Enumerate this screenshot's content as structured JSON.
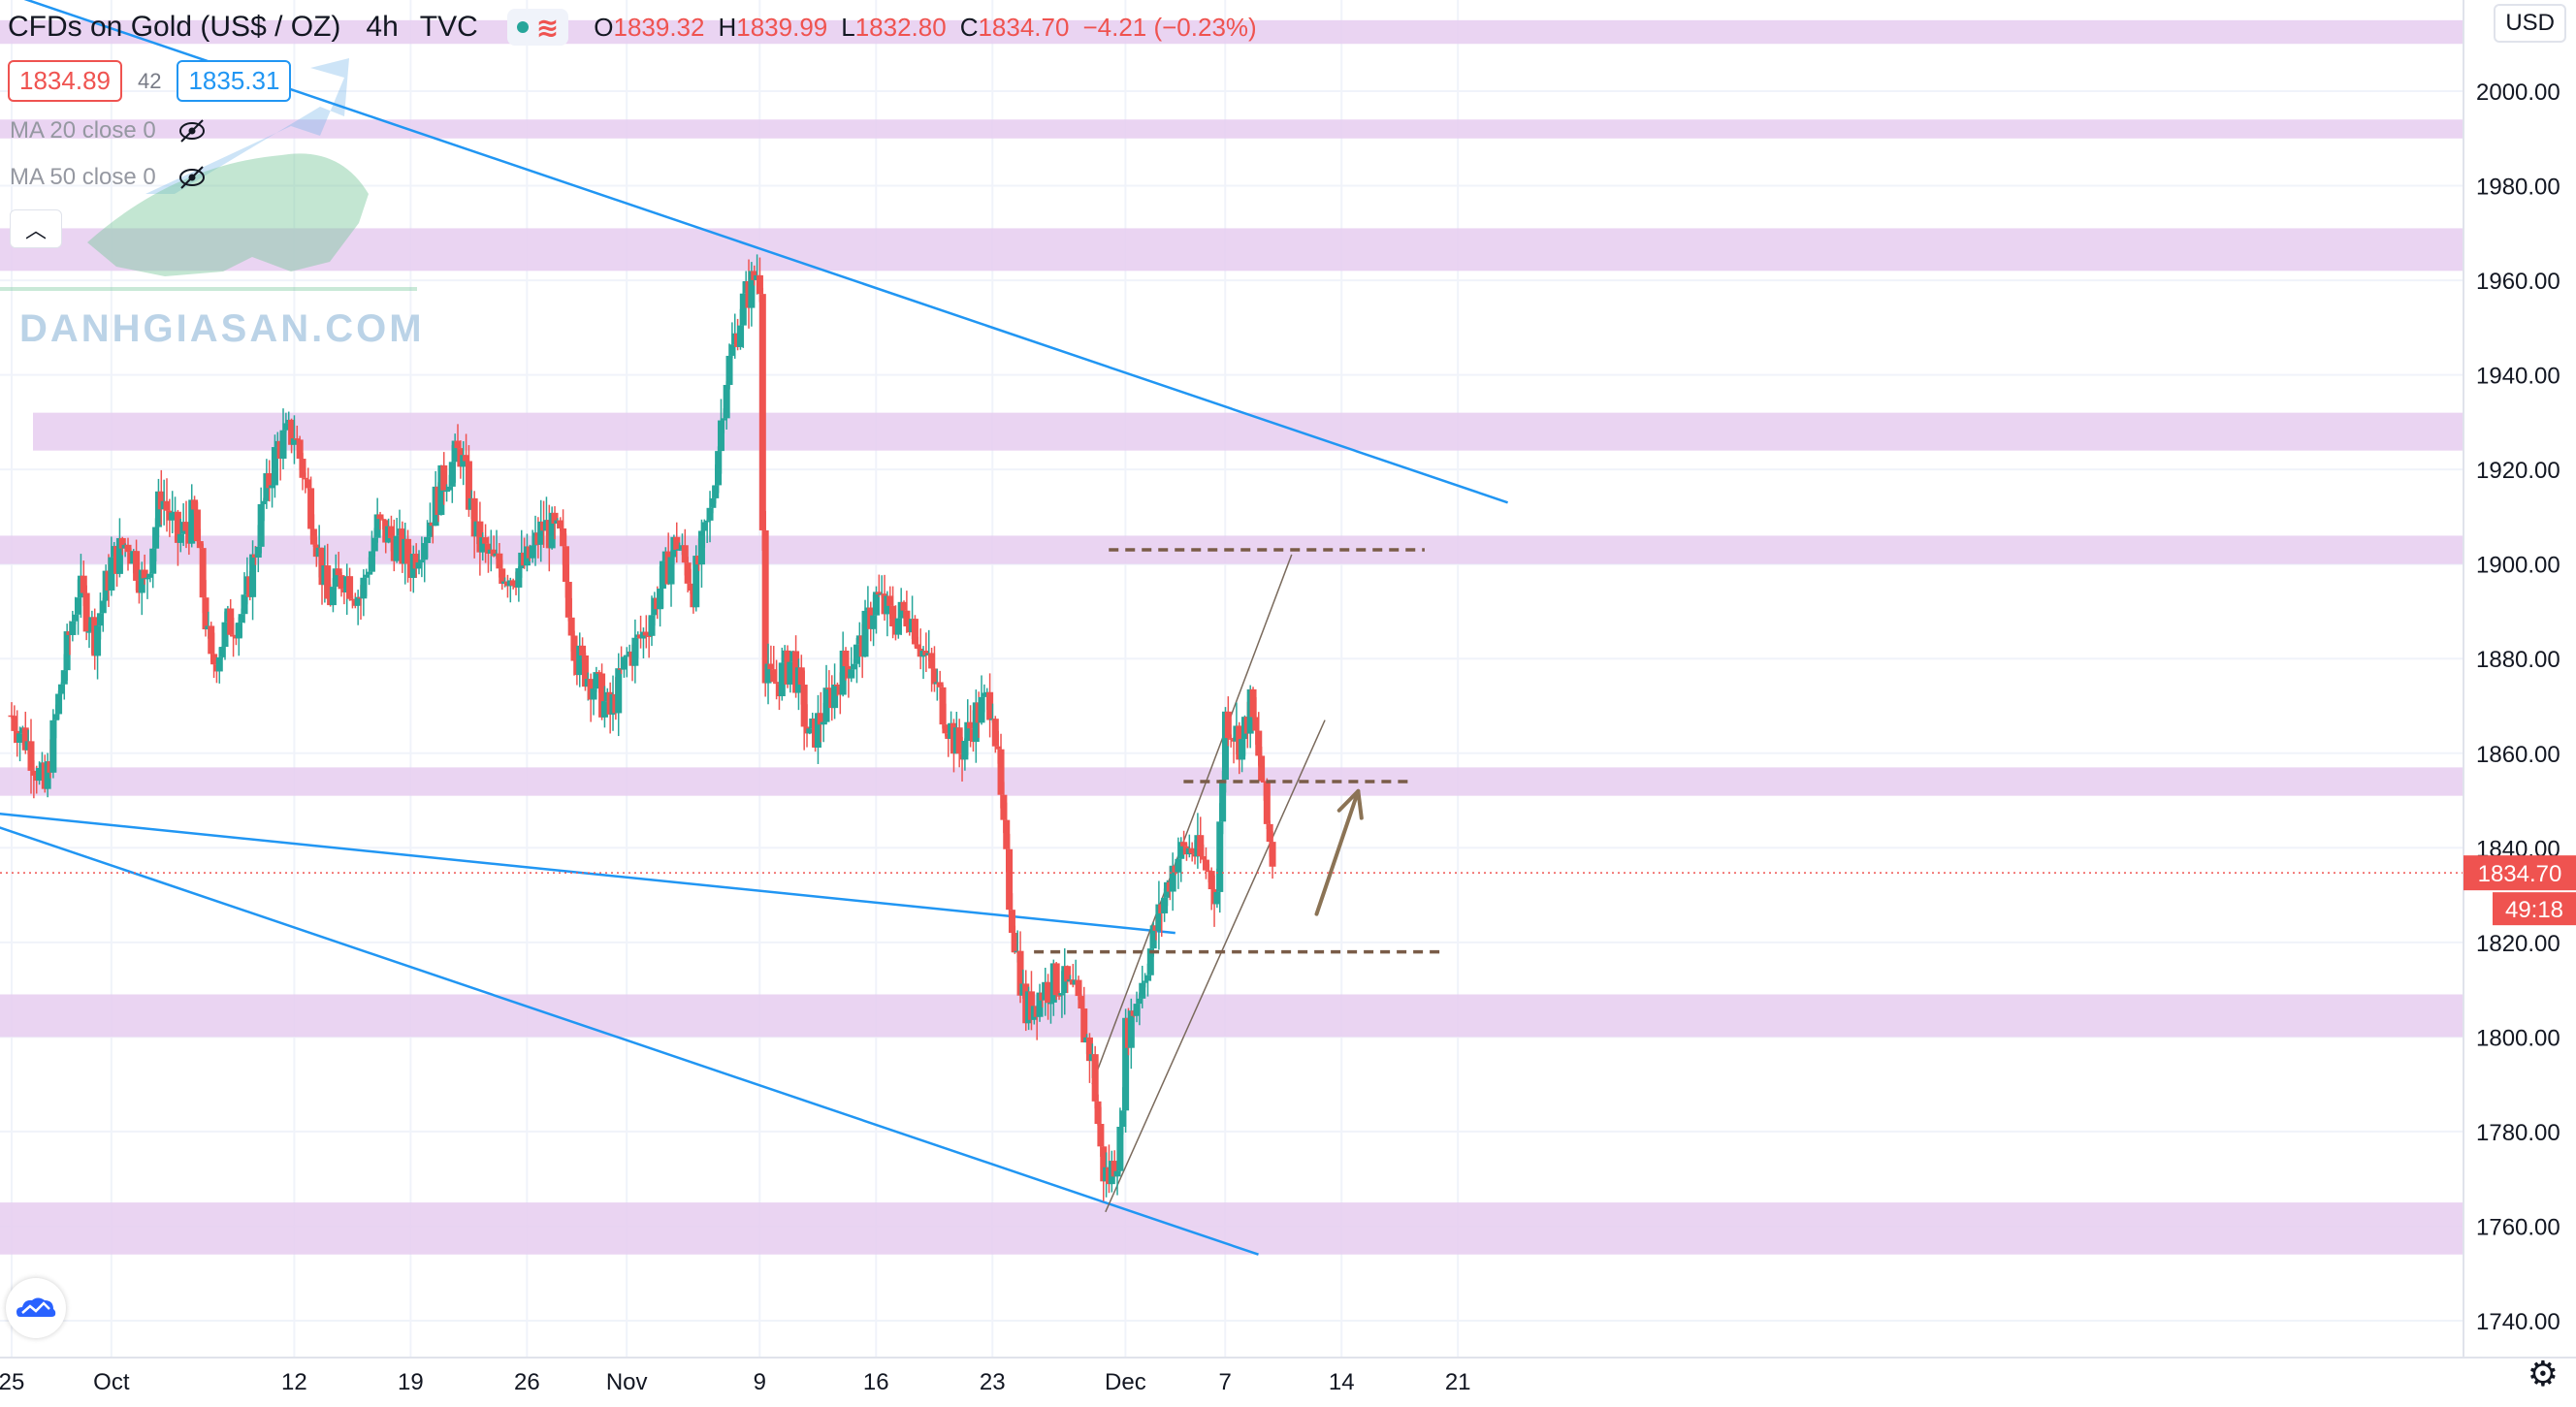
{
  "header": {
    "symbol": "CFDs on Gold (US$ / OZ)",
    "timeframe": "4h",
    "source": "TVC",
    "open_label": "O",
    "open": "1839.32",
    "high_label": "H",
    "high": "1839.99",
    "low_label": "L",
    "low": "1832.80",
    "close_label": "C",
    "close": "1834.70",
    "change": "−4.21 (−0.23%)"
  },
  "trade": {
    "sell": "1834.89",
    "spread": "42",
    "buy": "1835.31"
  },
  "indicators": [
    {
      "label": "MA 20 close 0"
    },
    {
      "label": "MA 50 close 0"
    }
  ],
  "currency": "USD",
  "watermark": "DANHGIASAN.COM",
  "price_label": {
    "value": "1834.70",
    "countdown": "49:18"
  },
  "colors": {
    "up": "#26a69a",
    "down": "#ef5350",
    "zone": "#e6cdf0",
    "trendline": "#2196f3",
    "level": "#7a5c48",
    "arrow": "#8b7355"
  },
  "chart_data": {
    "type": "candlestick",
    "title": "CFDs on Gold (US$ / OZ) 4h",
    "ylim": [
      1732,
      2020
    ],
    "y_ticks": [
      "2000.00",
      "1980.00",
      "1960.00",
      "1940.00",
      "1920.00",
      "1900.00",
      "1880.00",
      "1860.00",
      "1840.00",
      "1820.00",
      "1800.00",
      "1780.00",
      "1760.00",
      "1740.00"
    ],
    "y_tick_values": [
      2000,
      1980,
      1960,
      1940,
      1920,
      1900,
      1880,
      1860,
      1840,
      1820,
      1800,
      1780,
      1760,
      1740
    ],
    "x_ticks": [
      {
        "label": "25",
        "day": 0
      },
      {
        "label": "Oct",
        "day": 6
      },
      {
        "label": "12",
        "day": 17
      },
      {
        "label": "19",
        "day": 24
      },
      {
        "label": "26",
        "day": 31
      },
      {
        "label": "Nov",
        "day": 37
      },
      {
        "label": "9",
        "day": 45
      },
      {
        "label": "16",
        "day": 52
      },
      {
        "label": "23",
        "day": 59
      },
      {
        "label": "Dec",
        "day": 67
      },
      {
        "label": "7",
        "day": 73
      },
      {
        "label": "14",
        "day": 80
      },
      {
        "label": "21",
        "day": 87
      }
    ],
    "candle_path": [
      {
        "day": 0,
        "p": 1868
      },
      {
        "day": 1,
        "p": 1862
      },
      {
        "day": 2,
        "p": 1852
      },
      {
        "day": 3,
        "p": 1875
      },
      {
        "day": 4,
        "p": 1895
      },
      {
        "day": 5,
        "p": 1885
      },
      {
        "day": 6,
        "p": 1900
      },
      {
        "day": 7,
        "p": 1905
      },
      {
        "day": 8,
        "p": 1895
      },
      {
        "day": 9,
        "p": 1915
      },
      {
        "day": 10,
        "p": 1905
      },
      {
        "day": 11,
        "p": 1910
      },
      {
        "day": 12,
        "p": 1878
      },
      {
        "day": 13,
        "p": 1887
      },
      {
        "day": 14,
        "p": 1890
      },
      {
        "day": 15,
        "p": 1910
      },
      {
        "day": 16,
        "p": 1925
      },
      {
        "day": 17,
        "p": 1928
      },
      {
        "day": 18,
        "p": 1912
      },
      {
        "day": 19,
        "p": 1892
      },
      {
        "day": 20,
        "p": 1898
      },
      {
        "day": 21,
        "p": 1893
      },
      {
        "day": 22,
        "p": 1908
      },
      {
        "day": 23,
        "p": 1905
      },
      {
        "day": 24,
        "p": 1900
      },
      {
        "day": 25,
        "p": 1908
      },
      {
        "day": 26,
        "p": 1918
      },
      {
        "day": 27,
        "p": 1924
      },
      {
        "day": 28,
        "p": 1905
      },
      {
        "day": 29,
        "p": 1900
      },
      {
        "day": 30,
        "p": 1898
      },
      {
        "day": 31,
        "p": 1900
      },
      {
        "day": 32,
        "p": 1908
      },
      {
        "day": 33,
        "p": 1905
      },
      {
        "day": 34,
        "p": 1880
      },
      {
        "day": 35,
        "p": 1875
      },
      {
        "day": 36,
        "p": 1868
      },
      {
        "day": 37,
        "p": 1880
      },
      {
        "day": 38,
        "p": 1885
      },
      {
        "day": 39,
        "p": 1895
      },
      {
        "day": 40,
        "p": 1905
      },
      {
        "day": 41,
        "p": 1895
      },
      {
        "day": 42,
        "p": 1910
      },
      {
        "day": 43,
        "p": 1940
      },
      {
        "day": 44,
        "p": 1955
      },
      {
        "day": 45,
        "p": 1963
      },
      {
        "day": 45.3,
        "p": 1875
      },
      {
        "day": 46,
        "p": 1875
      },
      {
        "day": 47,
        "p": 1880
      },
      {
        "day": 48,
        "p": 1862
      },
      {
        "day": 49,
        "p": 1870
      },
      {
        "day": 50,
        "p": 1878
      },
      {
        "day": 51,
        "p": 1882
      },
      {
        "day": 52,
        "p": 1893
      },
      {
        "day": 53,
        "p": 1888
      },
      {
        "day": 54,
        "p": 1890
      },
      {
        "day": 55,
        "p": 1880
      },
      {
        "day": 56,
        "p": 1870
      },
      {
        "day": 57,
        "p": 1860
      },
      {
        "day": 58,
        "p": 1868
      },
      {
        "day": 59,
        "p": 1872
      },
      {
        "day": 59.6,
        "p": 1845
      },
      {
        "day": 60,
        "p": 1830
      },
      {
        "day": 61,
        "p": 1805
      },
      {
        "day": 62,
        "p": 1810
      },
      {
        "day": 63,
        "p": 1812
      },
      {
        "day": 64,
        "p": 1808
      },
      {
        "day": 65,
        "p": 1795
      },
      {
        "day": 65.6,
        "p": 1772
      },
      {
        "day": 66,
        "p": 1770
      },
      {
        "day": 66.7,
        "p": 1778
      },
      {
        "day": 67,
        "p": 1800
      },
      {
        "day": 68,
        "p": 1812
      },
      {
        "day": 69,
        "p": 1825
      },
      {
        "day": 70,
        "p": 1838
      },
      {
        "day": 71,
        "p": 1840
      },
      {
        "day": 72,
        "p": 1835
      },
      {
        "day": 72.5,
        "p": 1830
      },
      {
        "day": 73,
        "p": 1868
      },
      {
        "day": 74,
        "p": 1862
      },
      {
        "day": 74.5,
        "p": 1870
      },
      {
        "day": 75,
        "p": 1860
      },
      {
        "day": 75.5,
        "p": 1845
      },
      {
        "day": 76,
        "p": 1835
      }
    ],
    "zones": [
      [
        2010,
        2015
      ],
      [
        1990,
        1994
      ],
      [
        1962,
        1971
      ],
      [
        1924,
        1932
      ],
      [
        1900,
        1906
      ],
      [
        1851,
        1857
      ],
      [
        1800,
        1809
      ],
      [
        1754,
        1765
      ]
    ],
    "trendlines": [
      {
        "x1": -3,
        "y1": 2024,
        "x2": 90,
        "y2": 1913
      },
      {
        "x1": -3,
        "y1": 1848,
        "x2": 70,
        "y2": 1822
      },
      {
        "x1": -3,
        "y1": 1847,
        "x2": 75,
        "y2": 1754
      },
      {
        "x1": 65,
        "y1": 1790,
        "x2": 77,
        "y2": 1902
      },
      {
        "x1": 65.8,
        "y1": 1763,
        "x2": 79,
        "y2": 1867
      }
    ],
    "levels": [
      {
        "x1": 66,
        "x2": 85,
        "y": 1903
      },
      {
        "x1": 70.5,
        "x2": 84,
        "y": 1854
      },
      {
        "x1": 61.5,
        "x2": 86,
        "y": 1818
      }
    ],
    "arrow": {
      "x1": 78.5,
      "y1": 1826,
      "x2": 81,
      "y2": 1852
    },
    "current_price": 1834.7
  }
}
